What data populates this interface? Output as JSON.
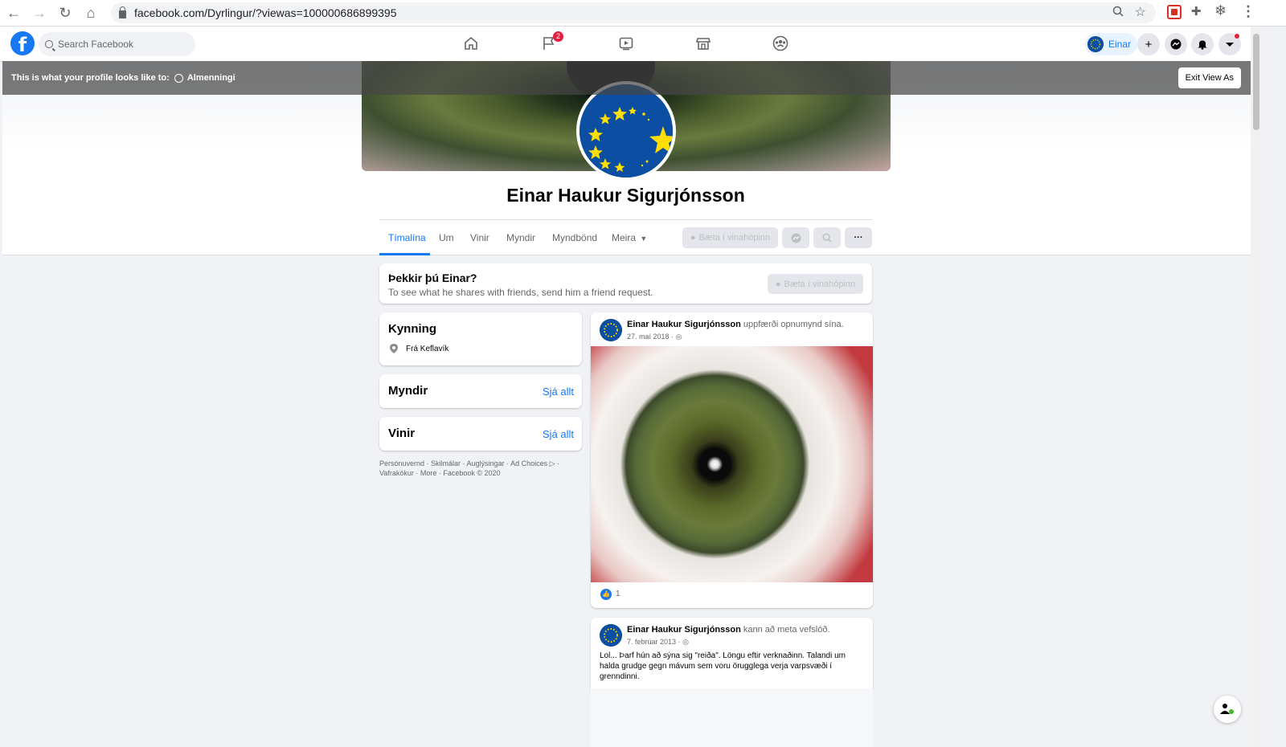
{
  "browser": {
    "url": "facebook.com/Dyrlingur/?viewas=100000686899395"
  },
  "fb_nav": {
    "logo": "f",
    "search_placeholder": "Search Facebook",
    "notification_badge": "2",
    "profile_name": "Einar",
    "icons": [
      "home-icon",
      "flag-icon",
      "watch-icon",
      "marketplace-icon",
      "groups-icon"
    ]
  },
  "view_as": {
    "label": "This is what your profile looks like to:",
    "audience": "Almenningi",
    "exit_label": "Exit View As"
  },
  "profile": {
    "name": "Einar Haukur Sigurjónsson",
    "tabs": [
      "Tímalína",
      "Um",
      "Vinir",
      "Myndir",
      "Myndbönd",
      "Meira"
    ],
    "add_friend_label": "Bæta í vinahópinn"
  },
  "friend_prompt": {
    "title": "Þekkir þú Einar?",
    "text": "To see what he shares with friends, send him a friend request.",
    "button": "Bæta í vinahópinn"
  },
  "intro": {
    "title": "Kynning",
    "location": "Frá Keflavík"
  },
  "photos": {
    "title": "Myndir",
    "see_all": "Sjá allt"
  },
  "friends": {
    "title": "Vinir",
    "see_all": "Sjá allt"
  },
  "footer": {
    "line1": "Persónuvernd · Skilmálar · Auglýsingar · Ad Choices ▷ ·",
    "line2": "Vafrakökur · More · Facebook © 2020"
  },
  "posts": [
    {
      "author": "Einar Haukur Sigurjónsson",
      "action": "uppfærði opnumynd sína.",
      "date": "27. maí 2018 ·",
      "likes": "1"
    },
    {
      "author": "Einar Haukur Sigurjónsson",
      "action": "kann að meta vefslóð.",
      "date": "7. febrúar 2013 ·",
      "text": "Lol... Þarf hún að sýna sig \"reiða\". Löngu eftir verknaðinn. Talandi um halda grudge gegn mávum sem voru örugglega verja varpsvæði í grenndinni."
    }
  ],
  "colors": {
    "fb_blue": "#1877f2",
    "eu_blue": "#0b4ea2",
    "eu_gold": "#ffde00"
  }
}
